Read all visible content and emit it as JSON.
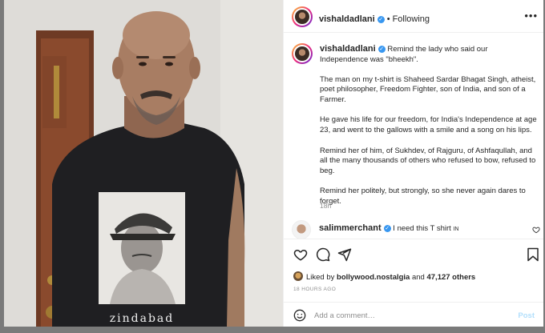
{
  "header": {
    "username": "vishaldadlani",
    "separator": "•",
    "follow_status": "Following",
    "more": "•••"
  },
  "caption": {
    "username": "vishaldadlani",
    "first_line": "Remind the lady who said our Independence was \"bheekh\".",
    "paragraphs": [
      "The man on my t-shirt is Shaheed Sardar Bhagat Singh, atheist, poet philosopher, Freedom Fighter, son of India, and son of a Farmer.",
      "He gave his life for our freedom, for India's Independence at age 23, and went to the gallows with a smile and a song on his lips.",
      "Remind her of him, of Sukhdev, of Rajguru, of Ashfaqullah, and all the many thousands of others who refused to bow, refused to beg.",
      "Remind her politely, but strongly, so she never again dares to forget."
    ],
    "time": "18h"
  },
  "comment": {
    "username": "salimmerchant",
    "text": "I need this T shirt",
    "flag": "IN"
  },
  "likes": {
    "prefix": "Liked by",
    "user": "bollywood.nostalgia",
    "middle": "and",
    "count": "47,127 others"
  },
  "post_time": "18 HOURS AGO",
  "add_comment": {
    "placeholder": "Add a comment…",
    "post_label": "Post"
  },
  "photo": {
    "tshirt_text": "zindabad"
  },
  "icons": {
    "verified": "verified-badge-icon",
    "like": "heart-icon",
    "comment": "comment-icon",
    "share": "send-icon",
    "save": "bookmark-icon",
    "emoji": "smiley-icon",
    "more": "more-options-icon"
  },
  "colors": {
    "verified_blue": "#3897f0",
    "post_button": "#b2dffc",
    "muted_text": "#8e8e8e"
  }
}
